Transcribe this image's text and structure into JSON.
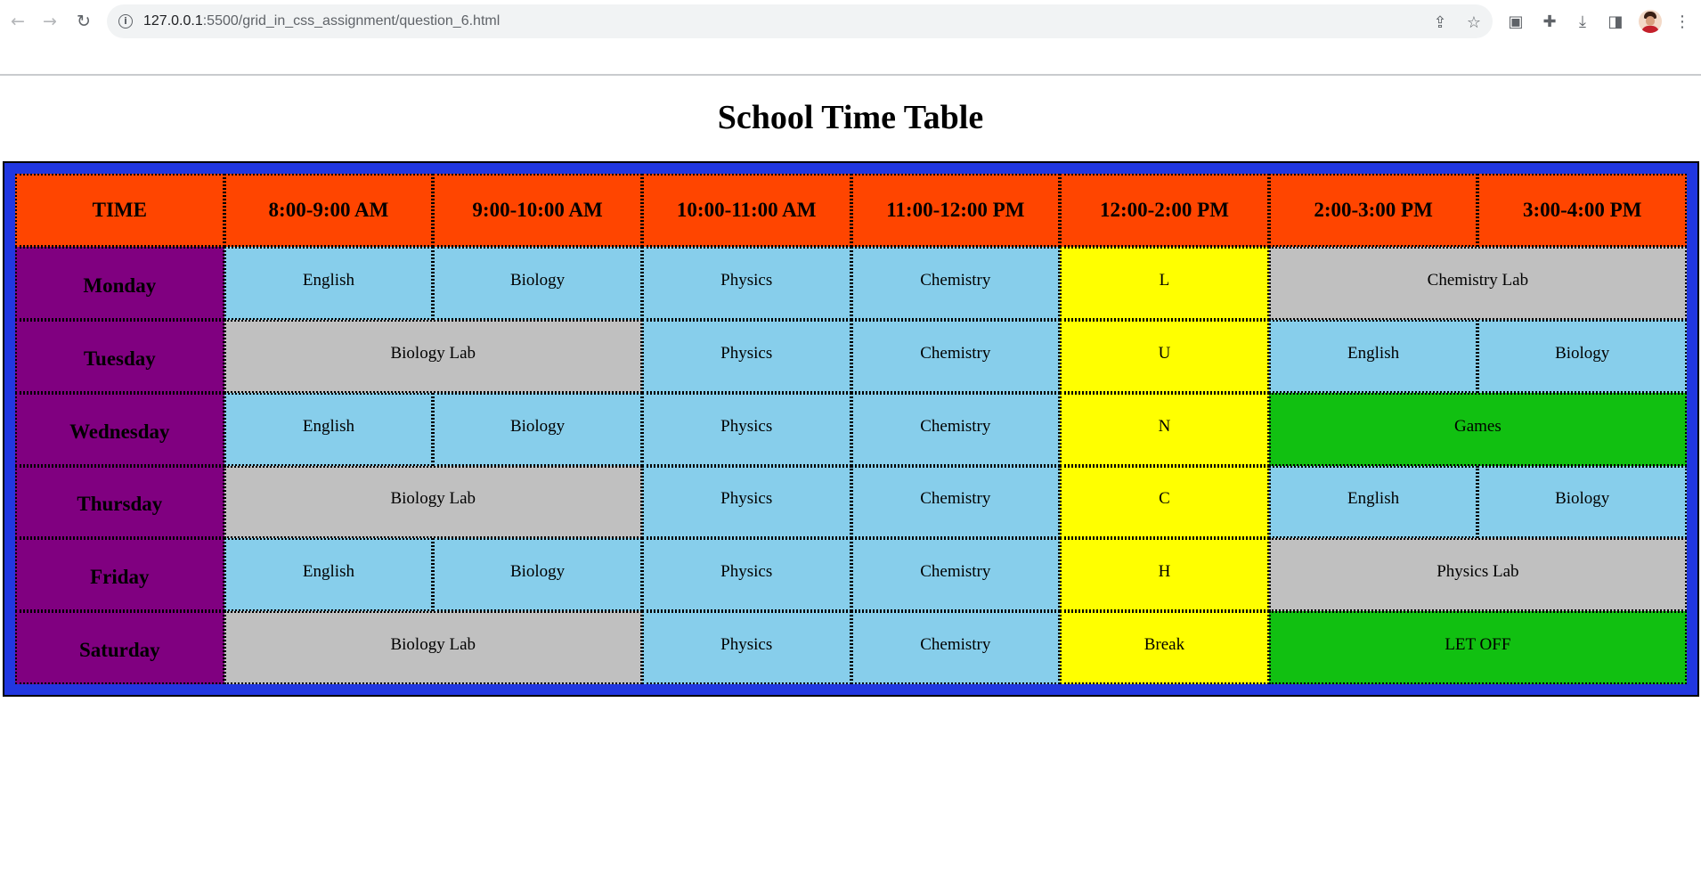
{
  "browser": {
    "url_host": "127.0.0.1",
    "url_path": ":5500/grid_in_css_assignment/question_6.html",
    "nav_icons": [
      "back-arrow-icon",
      "forward-arrow-icon",
      "reload-icon"
    ],
    "omnibox_icons": [
      "site-info-icon",
      "share-icon",
      "bookmark-star-icon"
    ],
    "toolbar_icons": [
      "picture-in-picture-icon",
      "extensions-puzzle-icon",
      "download-icon",
      "side-panel-icon",
      "profile-avatar",
      "kebab-menu-icon"
    ]
  },
  "page": {
    "title": "School Time Table"
  },
  "timetable": {
    "header": [
      "TIME",
      "8:00-9:00 AM",
      "9:00-10:00 AM",
      "10:00-11:00 AM",
      "11:00-12:00 PM",
      "12:00-2:00 PM",
      "2:00-3:00 PM",
      "3:00-4:00 PM"
    ],
    "days": [
      "Monday",
      "Tuesday",
      "Wednesday",
      "Thursday",
      "Friday",
      "Saturday"
    ],
    "lunch_column": [
      "L",
      "U",
      "N",
      "C",
      "H",
      "Break"
    ],
    "rows": {
      "monday": {
        "p1": "English",
        "p2": "Biology",
        "p3": "Physics",
        "p4": "Chemistry",
        "afternoon": "Chemistry Lab"
      },
      "tuesday": {
        "morning": "Biology Lab",
        "p3": "Physics",
        "p4": "Chemistry",
        "p5": "English",
        "p6": "Biology"
      },
      "wednesday": {
        "p1": "English",
        "p2": "Biology",
        "p3": "Physics",
        "p4": "Chemistry",
        "afternoon": "Games"
      },
      "thursday": {
        "morning": "Biology Lab",
        "p3": "Physics",
        "p4": "Chemistry",
        "p5": "English",
        "p6": "Biology"
      },
      "friday": {
        "p1": "English",
        "p2": "Biology",
        "p3": "Physics",
        "p4": "Chemistry",
        "afternoon": "Physics Lab"
      },
      "saturday": {
        "morning": "Biology Lab",
        "p3": "Physics",
        "p4": "Chemistry",
        "afternoon": "LET OFF"
      }
    },
    "colors": {
      "frame": "#2137e0",
      "header": "#ff4500",
      "day": "#800080",
      "subject": "#87ceeb",
      "lab": "#c0c0c0",
      "lunch": "#ffff00",
      "games": "#11c011"
    }
  }
}
